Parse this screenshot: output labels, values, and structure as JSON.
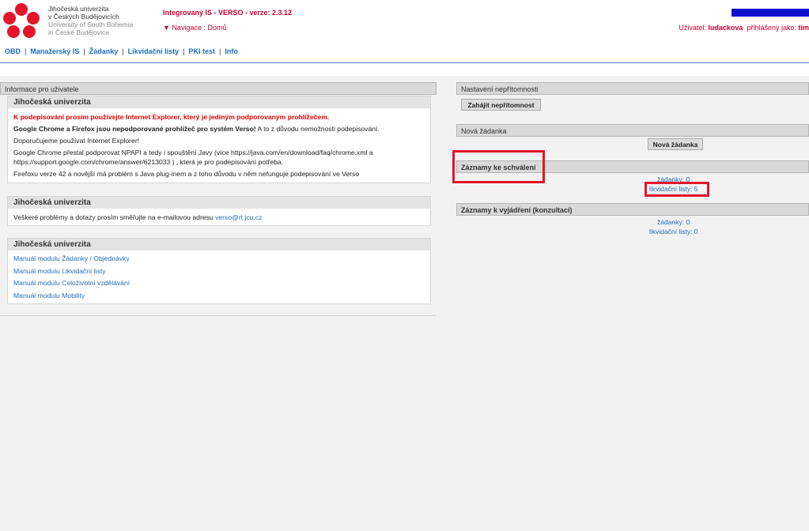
{
  "header": {
    "logo": {
      "line1": "Jihočeská univerzita",
      "line2": "v Českých Budějovicích",
      "line3": "University of South Bohemia",
      "line4": "in České Budějovice"
    },
    "app_title": "Integrovaný IS - VERSO - verze: 2.3.12",
    "nav_arrow": "▼",
    "nav_label": "Navigace : Domů",
    "user_label": "Uživatel: ",
    "user_name": "ludackova",
    "logged_as_label": "  přihlášený jako: ",
    "logged_as": "tim"
  },
  "menu": {
    "items": [
      "OBD",
      "Manažerský IS",
      "Žádanky",
      "Likvidační listy",
      "PKI test",
      "Info"
    ],
    "separator": "|"
  },
  "left": {
    "title": "Informace pro uživatele",
    "box1": {
      "head": "Jihočeská univerzita",
      "warning": "K podepisování prosím používejte Internet Explorer, který je jediným podporovaným prohlížečem.",
      "p2_bold": "Google Chrome a Firefox jsou nepodporované prohlížeč pro systém Verso!",
      "p2_rest": " A to z důvodu nemožnosti podepisování.",
      "p3": "Doporučujeme používat Internet Explorer!",
      "p4": "Google Chrome přestal podporovat NPAPI a tedy i spouštění Javy (více https://java.com/en/download/faq/chrome.xml a https://support.google.com/chrome/answer/6213033 ) , která je pro podepisování potřeba.",
      "p5": "Firefoxu verze 42 a novější má problém s Java plug-inem a z toho důvodu v něm nefunguje podepisování ve Verso"
    },
    "box2": {
      "head": "Jihočeská univerzita",
      "text": "Veškeré problémy a dotazy prosím směřujte na e-mailovou adresu ",
      "email": "verso@rt.jcu.cz"
    },
    "box3": {
      "head": "Jihočeská univerzita",
      "links": [
        "Manuál modulu Žádanky / Objednávky",
        "Manuál modulu Likvidační listy",
        "Manuál modulu Celoživotní vzdělávání",
        "Manuál modulu Mobility"
      ]
    }
  },
  "right": {
    "absence": {
      "title": "Nastavení nepřítomnosti",
      "button": "Zahájit nepřítomnost"
    },
    "new_request": {
      "title": "Nová žádanka",
      "button": "Nová žádanka"
    },
    "approval": {
      "title": "Záznamy ke schválení",
      "requests": "žádanky: 0",
      "liquidation": "likvidační listy: 5"
    },
    "consult": {
      "title": "Záznamy k vyjádření (konzultaci)",
      "requests": "žádanky: 0",
      "liquidation": "likvidační listy: 0"
    }
  },
  "colors": {
    "accent_red": "#cc0033",
    "link_blue": "#1f6fbf",
    "highlight_red": "#e3152b",
    "top_bar_blue": "#1010cc"
  }
}
